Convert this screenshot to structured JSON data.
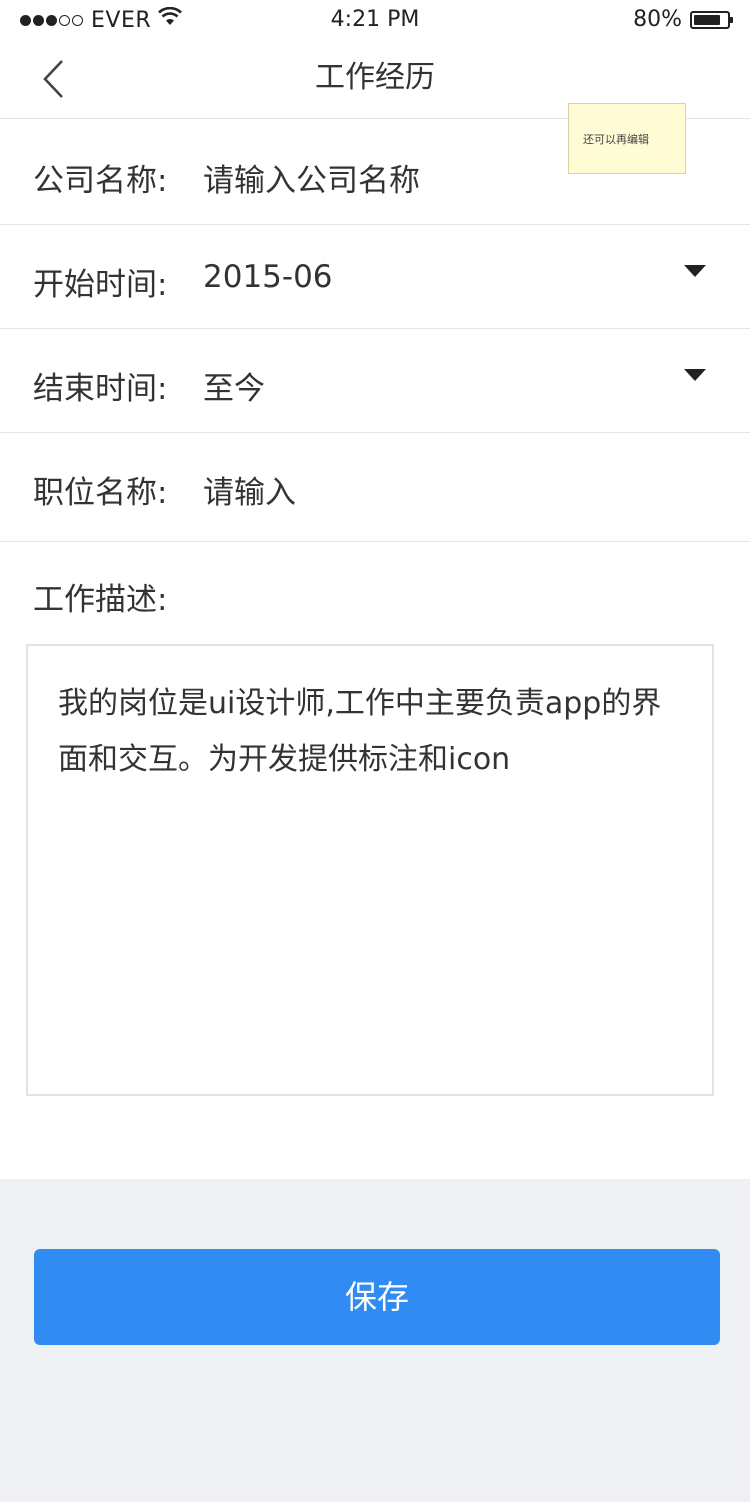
{
  "status_bar": {
    "carrier": "EVER",
    "time": "4:21 PM",
    "battery_percent": "80%",
    "battery_level": 0.8,
    "signal_bars_filled": 3,
    "signal_bars_total": 5
  },
  "nav": {
    "title": "工作经历",
    "back_icon": "chevron-left-icon"
  },
  "annotation_note": "还可以再编辑",
  "form": {
    "company": {
      "label": "公司名称:",
      "placeholder": "请输入公司名称"
    },
    "start_time": {
      "label": "开始时间:",
      "value": "2015-06",
      "icon": "caret-down-icon"
    },
    "end_time": {
      "label": "结束时间:",
      "value": "至今",
      "icon": "caret-down-icon"
    },
    "position": {
      "label": "职位名称:",
      "placeholder": "请输入"
    },
    "description": {
      "label": "工作描述:",
      "value": "我的岗位是ui设计师,工作中主要负责app的界面和交互。为开发提供标注和icon"
    }
  },
  "save_label": "保存",
  "colors": {
    "primary_button": "#308cf3",
    "bottom_background": "#eff0f4",
    "divider": "#e6e6e6",
    "text": "#333333",
    "note_background": "#fffbd5"
  }
}
